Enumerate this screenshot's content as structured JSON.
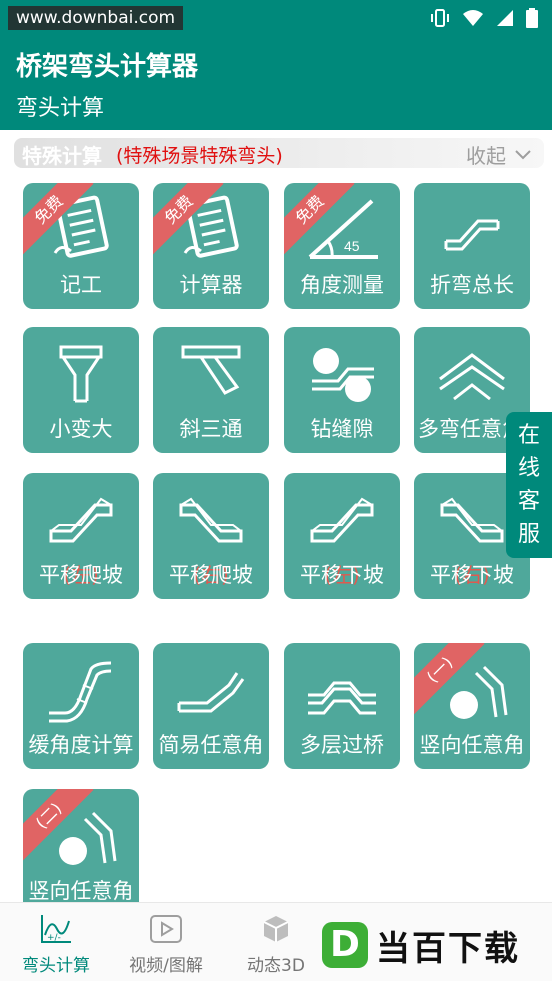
{
  "status_bar": {
    "watermark": "www.downbai.com",
    "icons": [
      "vibrate-icon",
      "wifi-icon",
      "signal-icon",
      "battery-icon"
    ]
  },
  "app_bar": {
    "title": "桥架弯头计算器",
    "subtitle": "弯头计算"
  },
  "section": {
    "title": "特殊计算",
    "note": "(特殊场景特殊弯头)",
    "collapse_label": "收起"
  },
  "tiles": [
    {
      "label": "记工",
      "badge": "免费"
    },
    {
      "label": "计算器",
      "badge": "免费"
    },
    {
      "label": "角度测量",
      "badge": "免费",
      "icon_text": "45"
    },
    {
      "label": "折弯总长"
    },
    {
      "label": "小变大"
    },
    {
      "label": "斜三通"
    },
    {
      "label": "钻缝隙"
    },
    {
      "label": "多弯任意角"
    },
    {
      "label": "平移爬坡",
      "sub": "(左)"
    },
    {
      "label": "平移爬坡",
      "sub": "(右)"
    },
    {
      "label": "平移下坡",
      "sub": "(左)"
    },
    {
      "label": "平移下坡",
      "sub": "(右)"
    },
    {
      "label": "缓角度计算"
    },
    {
      "label": "简易任意角"
    },
    {
      "label": "多层过桥"
    },
    {
      "label": "竖向任意角",
      "badge": "(一)"
    },
    {
      "label": "竖向任意角",
      "badge": "(二)"
    }
  ],
  "online_service": [
    "在",
    "线",
    "客",
    "服"
  ],
  "bottom_nav": [
    {
      "label": "弯头计算",
      "active": true
    },
    {
      "label": "视频/图解",
      "active": false
    },
    {
      "label": "动态3D",
      "active": false
    }
  ],
  "brand": {
    "logo_letter": "D",
    "text": "当百下载"
  },
  "colors": {
    "primary": "#00897b",
    "tile": "#4fa89b",
    "badge": "#e06464",
    "note_red": "#e01010"
  }
}
